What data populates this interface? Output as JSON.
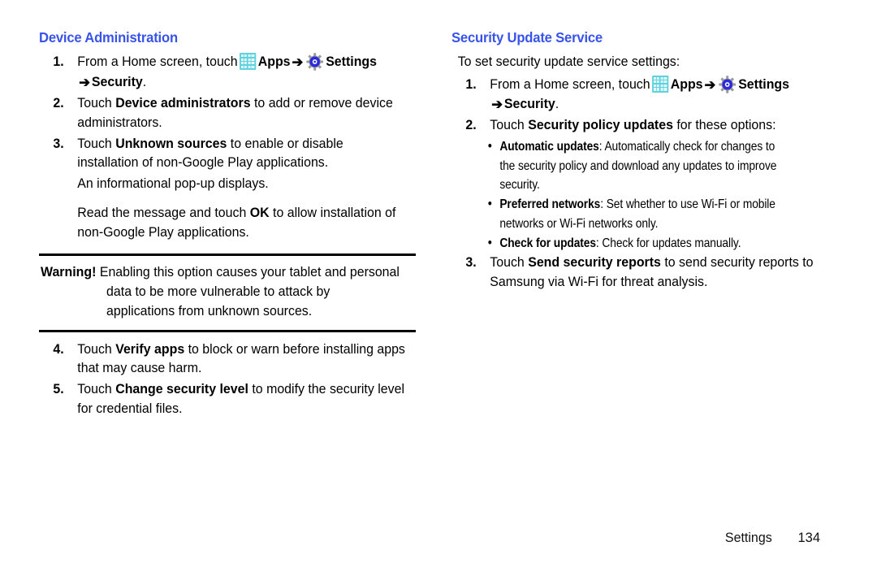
{
  "document": {
    "page_background": "#ffffff",
    "heading_color": "#3753ea"
  },
  "left_column": {
    "heading": "Device Administration",
    "steps": [
      {
        "number": "1.",
        "text_before_apps": "From a Home screen, touch",
        "apps_label": "Apps",
        "arrow": "➔",
        "settings_label": "Settings",
        "second_line_arrow": "➔",
        "second_line_label": "Security",
        "second_line_period": "."
      },
      {
        "number": "2.",
        "prefix": "Touch ",
        "bold": "Device administrators",
        "suffix": " to add or remove device administrators."
      },
      {
        "number": "3.",
        "prefix": "Touch ",
        "bold": "Unknown sources",
        "suffix": " to enable or disable installation of non-Google Play applications.",
        "para_1": "An informational pop-up displays.",
        "para_2_prefix": "Read the message and touch ",
        "para_2_bold": "OK",
        "para_2_suffix": " to allow installation of non-Google Play applications."
      },
      {
        "number": "4.",
        "prefix": "Touch ",
        "bold": "Verify apps",
        "suffix": " to block or warn before installing apps that may cause harm."
      },
      {
        "number": "5.",
        "prefix": "Touch ",
        "bold": "Change security level",
        "suffix": " to modify the security level for credential files."
      }
    ],
    "warning": {
      "label": "Warning!",
      "text": " Enabling this option causes your tablet and personal data to be more vulnerable to attack by applications from unknown sources."
    }
  },
  "right_column": {
    "heading": "Security Update Service",
    "intro": "To set security update service settings:",
    "steps": [
      {
        "number": "1.",
        "text_before_apps": "From a Home screen, touch",
        "apps_label": "Apps",
        "arrow": "➔",
        "settings_label": "Settings",
        "second_line_arrow": "➔",
        "second_line_label": "Security",
        "second_line_period": "."
      },
      {
        "number": "2.",
        "prefix": "Touch ",
        "bold": "Security policy updates",
        "suffix": " for these options:"
      },
      {
        "number": "3.",
        "prefix": "Touch ",
        "bold": "Send security reports",
        "suffix": " to send security reports to Samsung via Wi-Fi for threat analysis."
      }
    ],
    "bullets": [
      {
        "marker": "•",
        "bold": "Automatic updates",
        "text": ": Automatically check for changes to the security policy and download any updates to improve security."
      },
      {
        "marker": "•",
        "bold": "Preferred networks",
        "text": ": Set whether to use Wi-Fi or mobile networks or Wi-Fi networks only."
      },
      {
        "marker": "•",
        "bold": "Check for updates",
        "text": ": Check for updates manually."
      }
    ]
  },
  "footer": {
    "section_name": "Settings",
    "page_number": "134"
  },
  "icons": {
    "apps": "apps-grid-icon",
    "settings": "gear-icon",
    "arrow": "right-arrow-icon",
    "bullet": "bullet-dot-icon"
  }
}
